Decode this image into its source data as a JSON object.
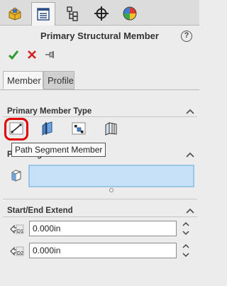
{
  "top_tabs": [
    {
      "name": "feature-manager-tab",
      "icon": "feature-manager-icon"
    },
    {
      "name": "property-manager-tab",
      "icon": "property-manager-icon",
      "active": true
    },
    {
      "name": "configuration-manager-tab",
      "icon": "configuration-manager-icon"
    },
    {
      "name": "dimxpert-manager-tab",
      "icon": "crosshair-icon"
    },
    {
      "name": "display-manager-tab",
      "icon": "appearance-sphere-icon"
    }
  ],
  "header": {
    "title": "Primary Structural Member",
    "help_label": "?"
  },
  "actions": {
    "ok": "check-icon",
    "cancel": "x-icon",
    "pin": "pushpin-icon"
  },
  "tabs": [
    {
      "label": "Member",
      "active": true
    },
    {
      "label": "Profile",
      "active": false
    }
  ],
  "primary_member_type": {
    "title": "Primary Member Type",
    "buttons": [
      "path-segment-member-icon",
      "reference-plane-member-icon",
      "points-member-icon",
      "face-member-icon"
    ],
    "selected": "path-segment-member-icon",
    "tooltip": "Path Segment Member"
  },
  "path_segments": {
    "title": "Path Segments",
    "value": ""
  },
  "start_end_extend": {
    "title": "Start/End Extend",
    "d1_value": "0.000in",
    "d2_value": "0.000in",
    "d1_label": "D1",
    "d2_label": "D2"
  },
  "colors": {
    "highlight_ring": "#e00000",
    "ok_green": "#2e9a2e",
    "cancel_red": "#d42020",
    "selection_fill": "#c7e2f8"
  }
}
